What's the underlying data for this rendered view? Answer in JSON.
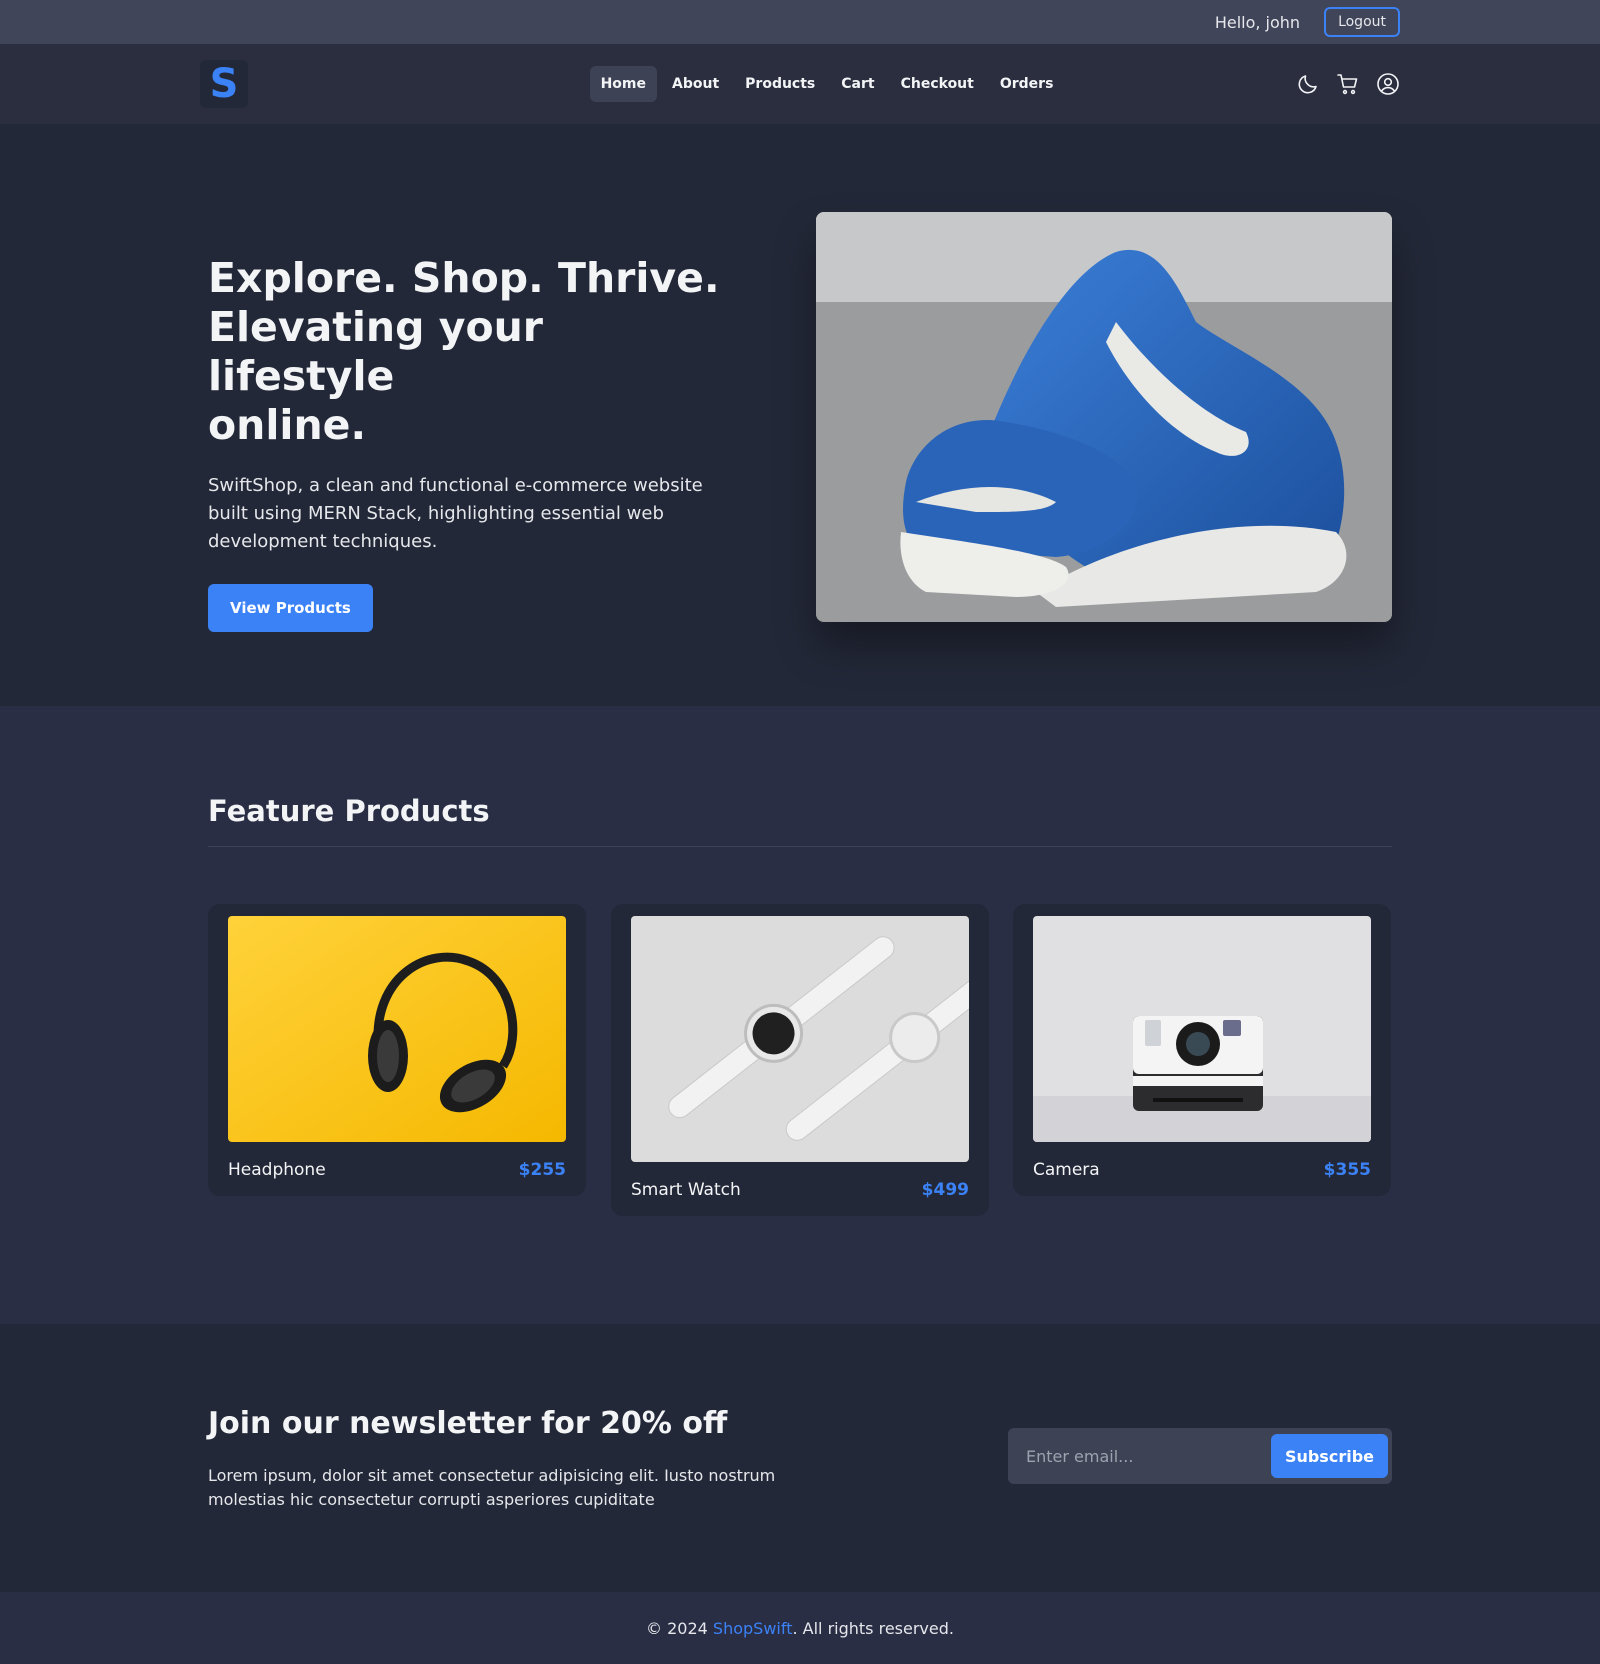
{
  "topbar": {
    "greeting": "Hello, john",
    "logout_label": "Logout"
  },
  "navbar": {
    "logo_letter": "S",
    "links": [
      {
        "label": "Home",
        "active": true
      },
      {
        "label": "About"
      },
      {
        "label": "Products"
      },
      {
        "label": "Cart"
      },
      {
        "label": "Checkout"
      },
      {
        "label": "Orders"
      }
    ],
    "icons": [
      "moon-icon",
      "cart-icon",
      "user-circle-icon"
    ]
  },
  "hero": {
    "title_lines": [
      "Explore. Shop. Thrive.",
      "Elevating your lifestyle",
      "online."
    ],
    "description": "SwiftShop, a clean and functional e-commerce website built using MERN Stack, highlighting essential web development techniques.",
    "button_label": "View Products",
    "image": "blue-puma-suede-sneakers"
  },
  "featured": {
    "title": "Feature Products",
    "products": [
      {
        "name": "Headphone",
        "price": "$255",
        "image": "headphones-on-yellow"
      },
      {
        "name": "Smart Watch",
        "price": "$499",
        "image": "white-smart-watches"
      },
      {
        "name": "Camera",
        "price": "$355",
        "image": "polaroid-camera"
      }
    ]
  },
  "newsletter": {
    "title": "Join our newsletter for 20% off",
    "description": "Lorem ipsum, dolor sit amet consectetur adipisicing elit. Iusto nostrum molestias hic consectetur corrupti asperiores cupiditate",
    "email_placeholder": "Enter email...",
    "subscribe_label": "Subscribe"
  },
  "footer": {
    "prefix": "© 2024",
    "brand": "ShopSwift",
    "suffix": ". All rights reserved."
  },
  "colors": {
    "accent": "#3b82f6",
    "background": "#232838",
    "surface": "#2a2e45"
  }
}
